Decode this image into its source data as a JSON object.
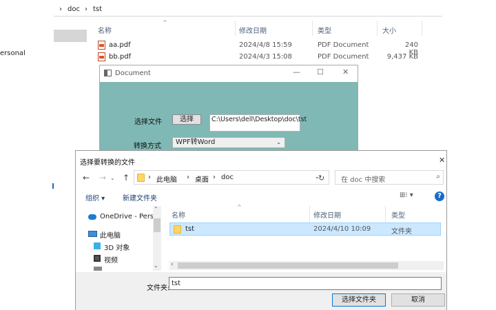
{
  "explorer": {
    "breadcrumb": [
      "doc",
      "tst"
    ],
    "nav_left_text": "ersonal",
    "columns": {
      "name": "名称",
      "date": "修改日期",
      "type": "类型",
      "size": "大小"
    },
    "files": [
      {
        "name": "aa.pdf",
        "date": "2024/4/8 15:59",
        "type": "PDF Document",
        "size": "240 KB"
      },
      {
        "name": "bb.pdf",
        "date": "2024/4/3 15:08",
        "type": "PDF Document",
        "size": "9,437 KB"
      }
    ]
  },
  "docwin": {
    "title": "Document",
    "controls": {
      "minimize": "—",
      "maximize": "☐",
      "close": "✕"
    },
    "select_file_label": "选择文件",
    "select_button": "选择",
    "path_value": "C:\\Users\\dell\\Desktop\\doc\\tst",
    "convert_label": "转换方式",
    "convert_selected": "WPF转Word"
  },
  "dialog": {
    "title": "选择要转换的文件",
    "close": "✕",
    "nav": {
      "back": "←",
      "forward": "→",
      "up": "↑"
    },
    "path_parts": [
      "此电脑",
      "桌面",
      "doc"
    ],
    "search_placeholder": "在 doc 中搜索",
    "toolbar": {
      "organize": "组织 ▾",
      "new_folder": "新建文件夹"
    },
    "help": "?",
    "nav_items": [
      {
        "label": "OneDrive - Perso",
        "icon": "cloud-icon"
      },
      {
        "label": "此电脑",
        "icon": "computer-icon"
      },
      {
        "label": "3D 对象",
        "icon": "cube-icon"
      },
      {
        "label": "视频",
        "icon": "video-icon"
      }
    ],
    "columns": {
      "name": "名称",
      "date": "修改日期",
      "type": "类型"
    },
    "rows": [
      {
        "name": "tst",
        "date": "2024/4/10 10:09",
        "type": "文件夹"
      }
    ],
    "filename_label": "文件夹:",
    "filename_value": "tst",
    "ok_button": "选择文件夹",
    "cancel_button": "取消"
  }
}
